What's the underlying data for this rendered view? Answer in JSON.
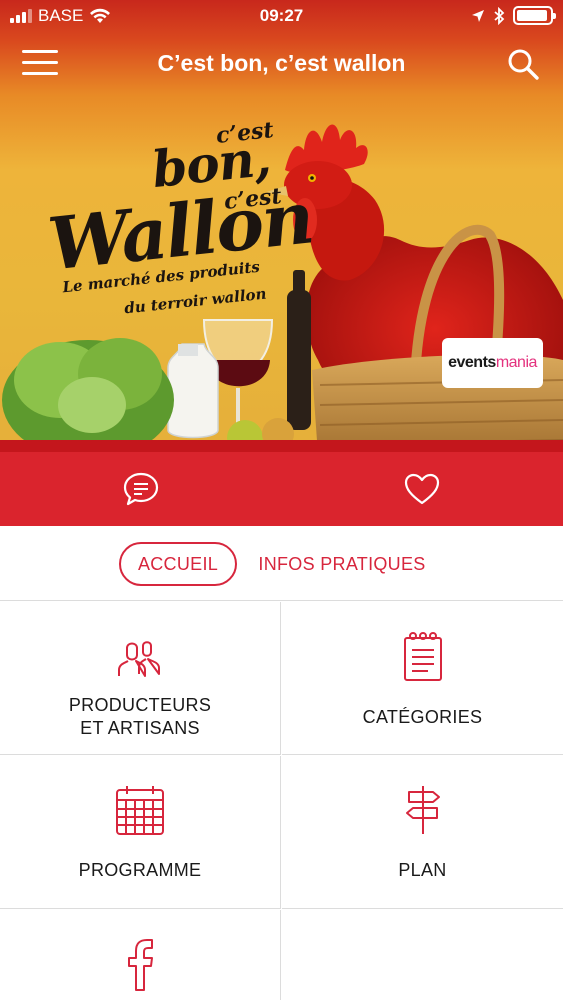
{
  "status_bar": {
    "carrier": "BASE",
    "time": "09:27",
    "battery_level": 0.95
  },
  "nav": {
    "title": "C’est bon, c’est wallon"
  },
  "poster": {
    "cest_top": "c’est",
    "bon": "bon,",
    "cest_bottom": "c’est",
    "wallon": "Wallon",
    "tagline_line1": "Le marché des produits",
    "tagline_line2": "du terroir wallon",
    "badge_main": "events",
    "badge_accent": "mania"
  },
  "tabs": [
    {
      "label": "ACCUEIL",
      "active": true
    },
    {
      "label": "INFOS PRATIQUES",
      "active": false
    }
  ],
  "grid": [
    {
      "label": "PRODUCTEURS\nET ARTISANS",
      "icon": "people-icon"
    },
    {
      "label": "CATÉGORIES",
      "icon": "notepad-icon"
    },
    {
      "label": "PROGRAMME",
      "icon": "calendar-icon"
    },
    {
      "label": "PLAN",
      "icon": "signpost-icon"
    },
    {
      "label": "",
      "icon": "facebook-icon"
    },
    {
      "label": "",
      "icon": ""
    }
  ],
  "colors": {
    "accent": "#d7263d",
    "header_red": "#c8281c",
    "poster_yellow": "#e9b63a",
    "action_bar": "#dd2630"
  }
}
